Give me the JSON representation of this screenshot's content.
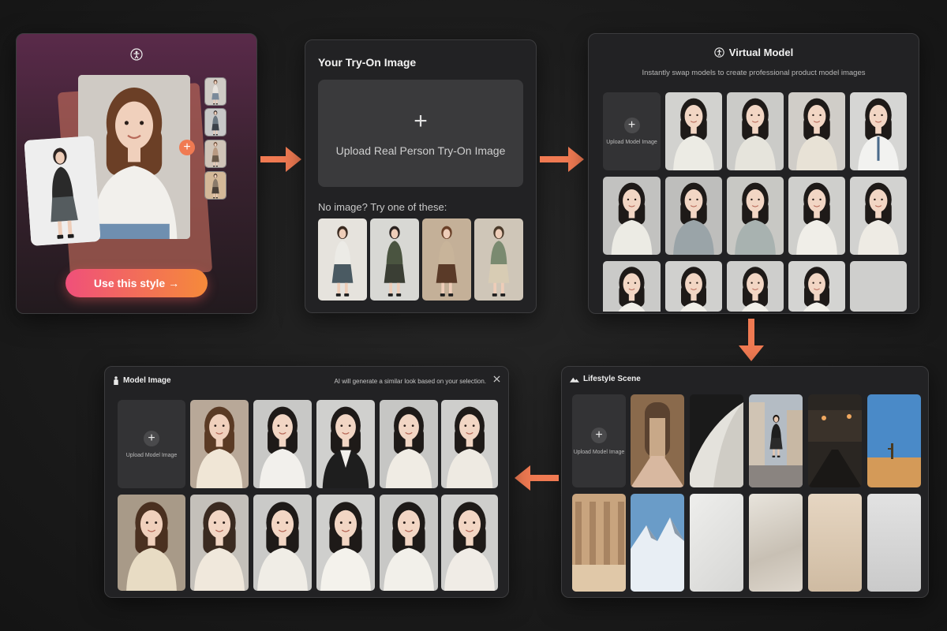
{
  "style_card": {
    "person_icon": "person-icon",
    "cta_label": "Use this style →"
  },
  "tryon": {
    "title": "Your Try-On Image",
    "upload_label": "Upload Real Person Try-On Image",
    "samples_label": "No image? Try one of these:"
  },
  "virtual_model": {
    "title": "Virtual Model",
    "subtitle": "Instantly swap models to create professional product model images",
    "upload_label": "Upload Model Image"
  },
  "lifestyle": {
    "title": "Lifestyle Scene",
    "upload_label": "Upload Model Image"
  },
  "model_image": {
    "title": "Model Image",
    "note": "AI will generate a similar look based on your selection.",
    "upload_label": "Upload Model Image"
  },
  "colors": {
    "accent": "#f07a52",
    "cta_gradient_start": "#f0507a",
    "cta_gradient_end": "#f58a3a",
    "panel_bg": "#222224"
  }
}
